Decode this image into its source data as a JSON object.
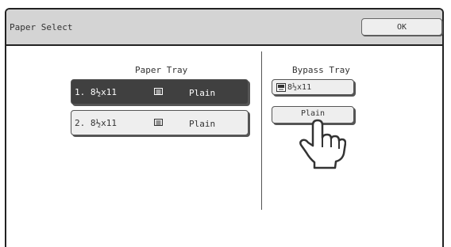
{
  "window": {
    "title": "Paper Select",
    "ok_label": "OK"
  },
  "paper_tray": {
    "heading": "Paper Tray",
    "items": [
      {
        "label": "1. 8½x11",
        "icon": "paper-stack-icon",
        "type": "Plain",
        "selected": true
      },
      {
        "label": "2. 8½x11",
        "icon": "paper-stack-icon",
        "type": "Plain",
        "selected": false
      }
    ]
  },
  "bypass_tray": {
    "heading": "Bypass Tray",
    "size_label": "8½x11",
    "size_icon": "bypass-tray-icon",
    "type_label": "Plain"
  },
  "pointer": {
    "icon": "pointing-hand-icon"
  },
  "colors": {
    "title_bar": "#d4d4d4",
    "selected_button": "#404040",
    "button": "#eeeeee",
    "border": "#222222"
  }
}
